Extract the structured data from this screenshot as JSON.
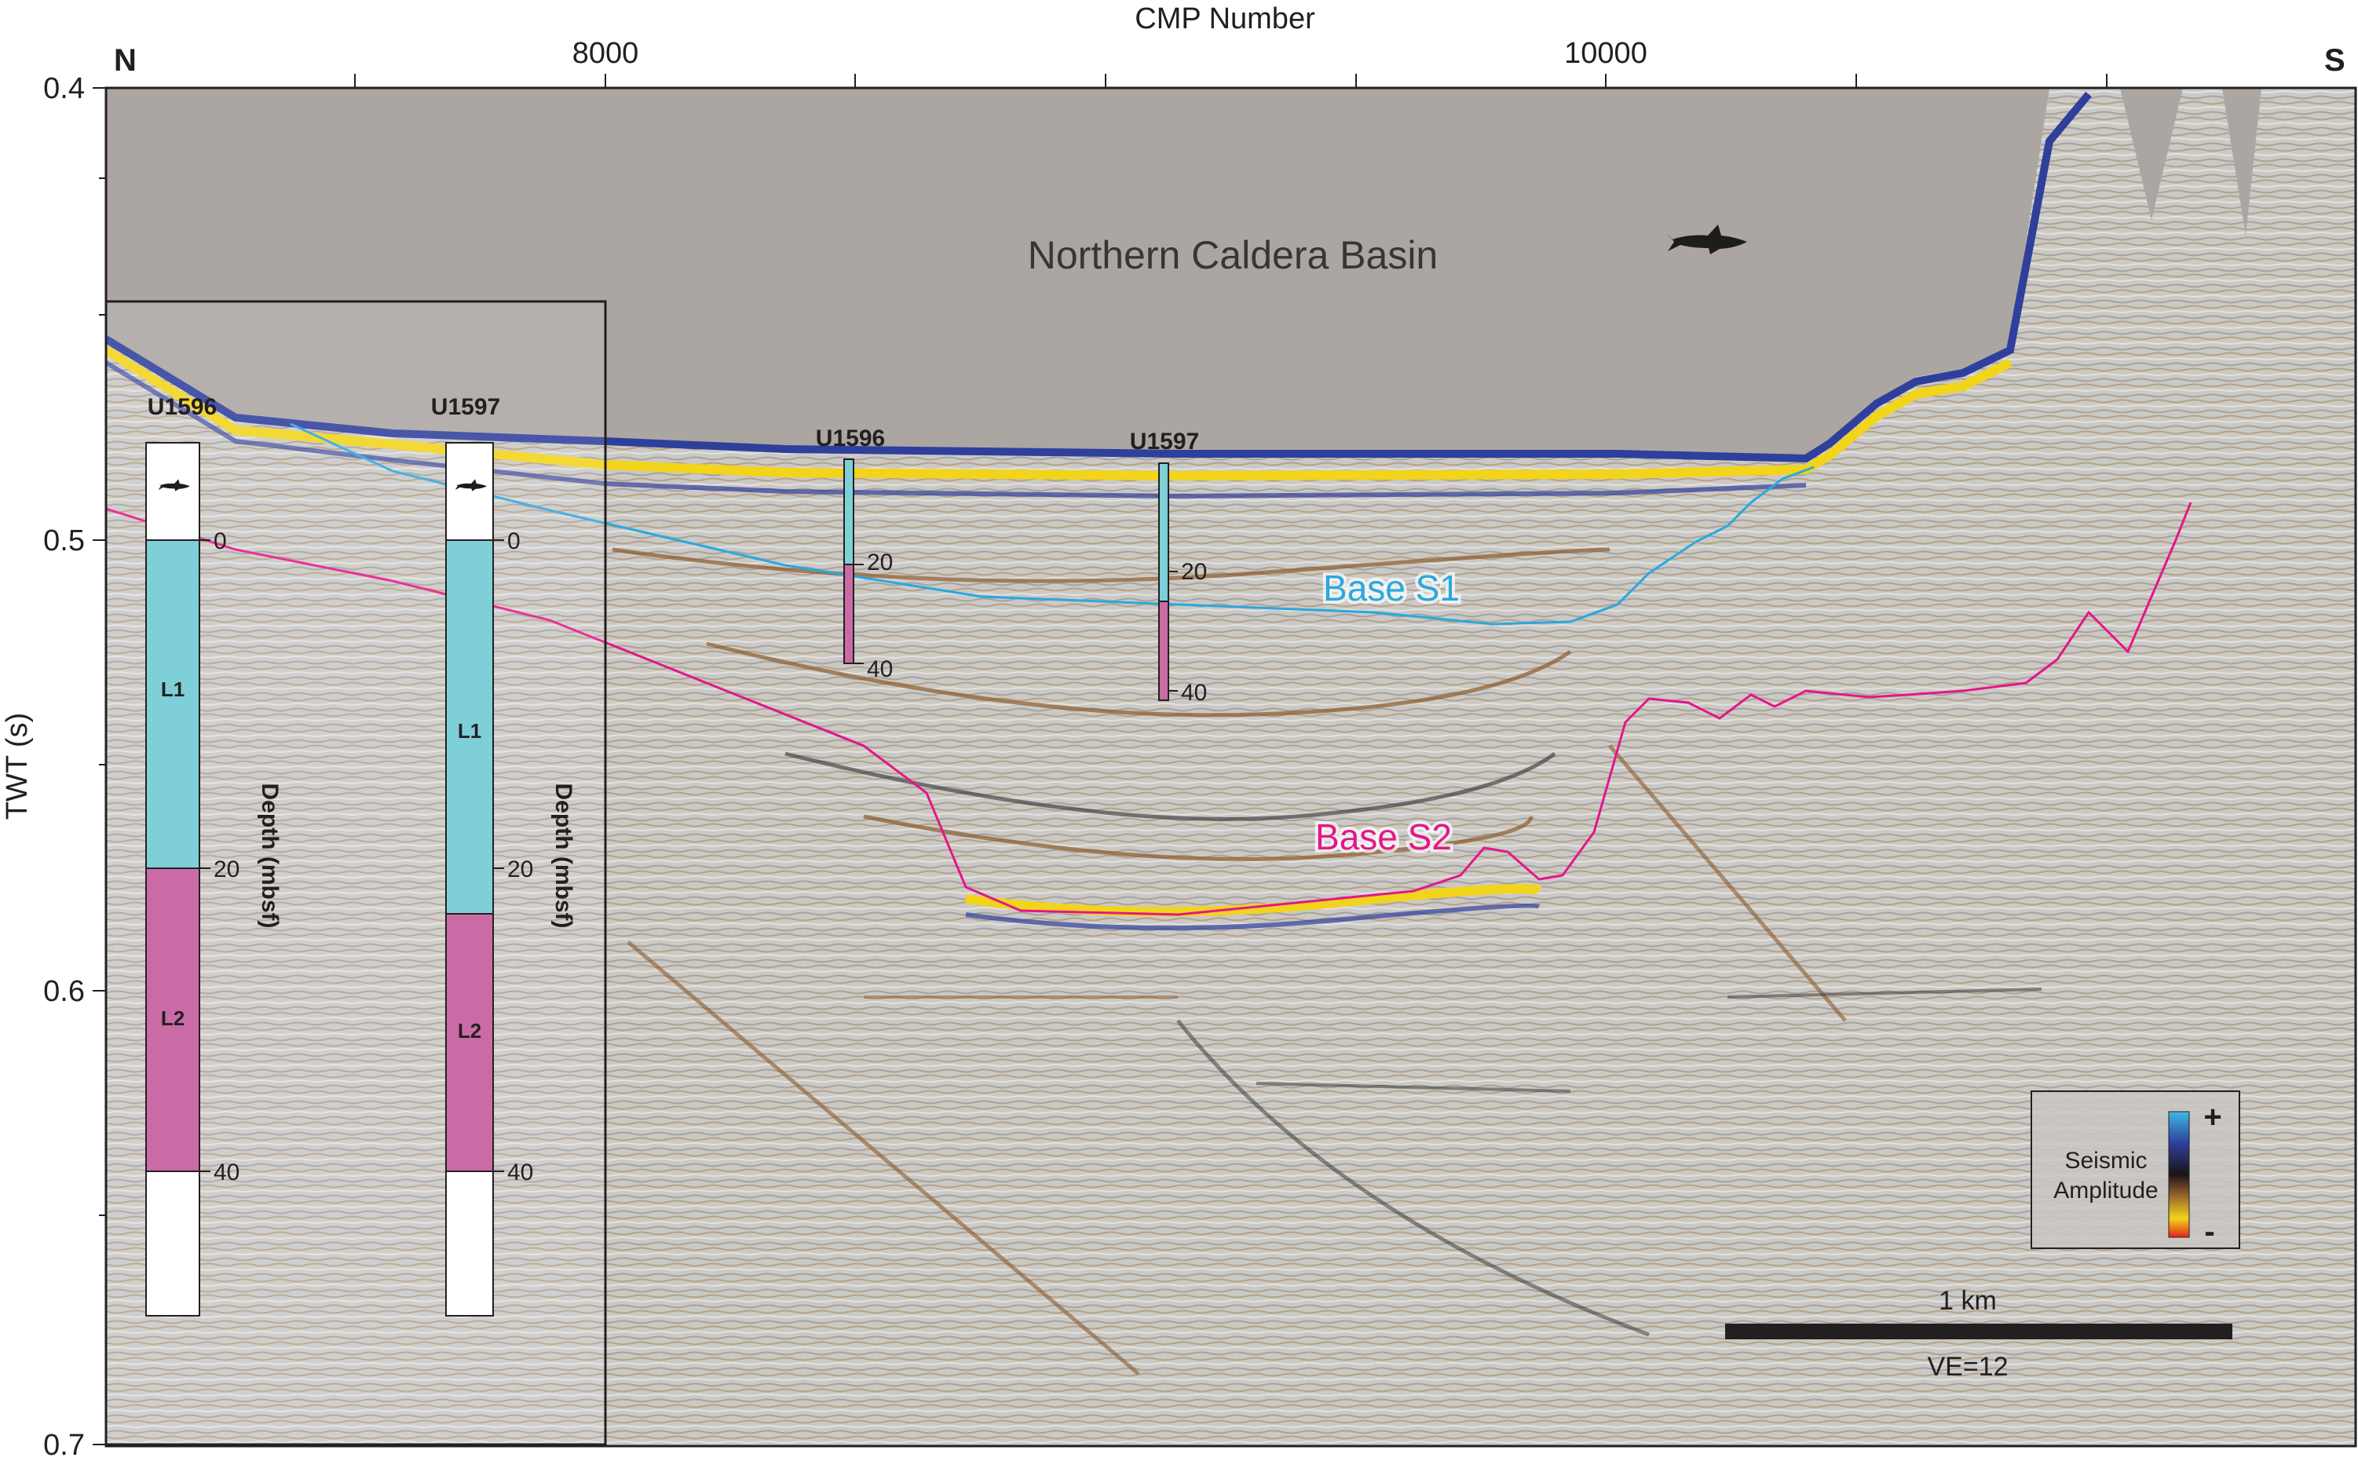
{
  "axes": {
    "x_title": "CMP Number",
    "y_title": "TWT (s)",
    "x_ticks": [
      "8000",
      "10000"
    ],
    "y_ticks": [
      "0.4",
      "0.5",
      "0.6",
      "0.7"
    ]
  },
  "compass": {
    "north": "N",
    "south": "S"
  },
  "basin_label": "Northern Caldera Basin",
  "horizons": [
    {
      "name": "Base S1",
      "color": "#29a8df"
    },
    {
      "name": "Base S2",
      "color": "#e4168a"
    }
  ],
  "sites": [
    {
      "name": "U1596",
      "boundary_depth_mbsf": 20,
      "total_depth_mbsf": 40
    },
    {
      "name": "U1597",
      "boundary_depth_mbsf": 23,
      "total_depth_mbsf": 40
    }
  ],
  "inset": {
    "depth_title": "Depth (mbsf)",
    "depth_ticks": [
      "0",
      "20",
      "40"
    ],
    "units": [
      {
        "name": "L1",
        "color": "#7fcfd9"
      },
      {
        "name": "L2",
        "color": "#cb6ba5"
      }
    ]
  },
  "legend": {
    "title_line1": "Seismic",
    "title_line2": "Amplitude",
    "plus": "+",
    "minus": "-"
  },
  "scale_bar": {
    "length_label": "1 km",
    "ve_label": "VE=12"
  },
  "colors": {
    "water": "#aba6a2",
    "seismic_background": "#c9c7c3",
    "positive_amplitude": "#f2d41b",
    "negative_amplitude": "#2f3f9c",
    "base_s1": "#29a8df",
    "base_s2": "#e4168a"
  },
  "icons": [
    "shark-icon"
  ]
}
